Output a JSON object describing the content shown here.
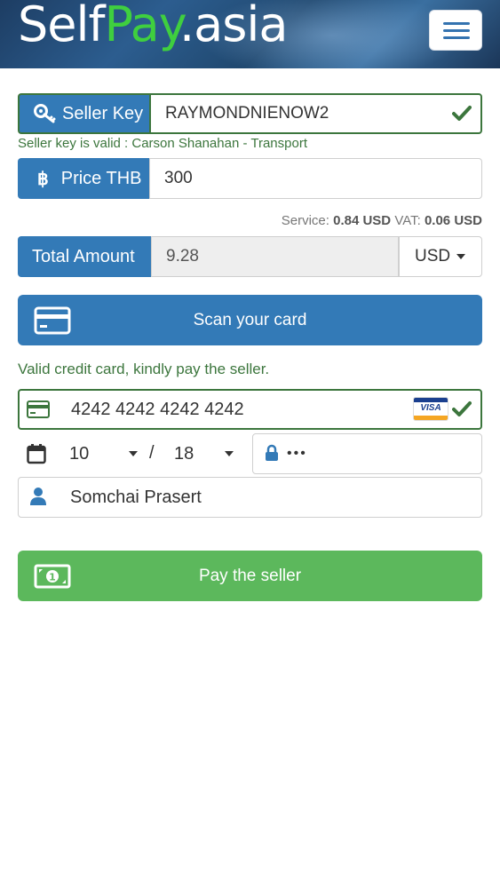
{
  "header": {
    "logo_part1": "Self",
    "logo_part2": "Pay",
    "logo_part3": ".asia"
  },
  "seller_key": {
    "label": "Seller Key",
    "value": "RAYMONDNIENOW2",
    "validation": "Seller key is valid : Carson Shanahan - Transport"
  },
  "price": {
    "label": "Price THB",
    "currency_symbol": "฿",
    "value": "300"
  },
  "fees": {
    "service_label": "Service:",
    "service_value": "0.84 USD",
    "vat_label": "VAT:",
    "vat_value": "0.06 USD"
  },
  "total": {
    "label": "Total Amount",
    "value": "9.28",
    "currency": "USD"
  },
  "scan_button": {
    "label": "Scan your card"
  },
  "card": {
    "valid_message": "Valid credit card, kindly pay the seller.",
    "number": "4242 4242 4242 4242",
    "brand": "VISA",
    "exp_month": "10",
    "exp_sep": "/",
    "exp_year": "18",
    "cvv": "•••",
    "holder": "Somchai Prasert"
  },
  "pay_button": {
    "label": "Pay the seller"
  },
  "colors": {
    "primary": "#337ab7",
    "success": "#5cb85c",
    "valid_text": "#3c763d",
    "logo_accent": "#3fcf3f"
  }
}
